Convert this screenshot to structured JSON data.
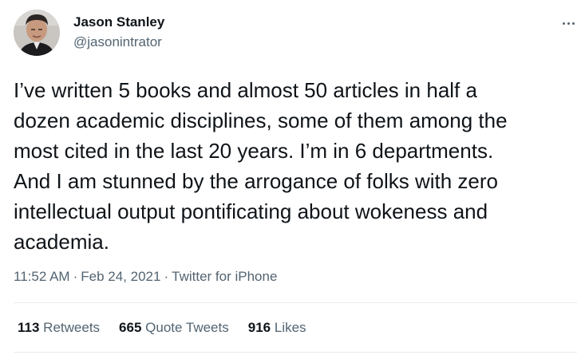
{
  "author": {
    "name": "Jason Stanley",
    "handle": "@jasonintrator"
  },
  "tweet": {
    "lines": [
      "I’ve written 5 books and almost 50 articles in half a",
      "dozen academic disciplines, some of them among the",
      "most cited in the last 20 years. I’m in 6 departments.",
      "And I am stunned by the arrogance of folks with zero",
      "intellectual output pontificating about wokeness and",
      "academia."
    ],
    "time": "11:52 AM",
    "date": "Feb 24, 2021",
    "source": "Twitter for iPhone",
    "separator": "·"
  },
  "stats": {
    "retweets": {
      "count": "113",
      "label": "Retweets"
    },
    "quote_tweets": {
      "count": "665",
      "label": "Quote Tweets"
    },
    "likes": {
      "count": "916",
      "label": "Likes"
    }
  },
  "icons": {
    "more": "more-horizontal-icon"
  }
}
